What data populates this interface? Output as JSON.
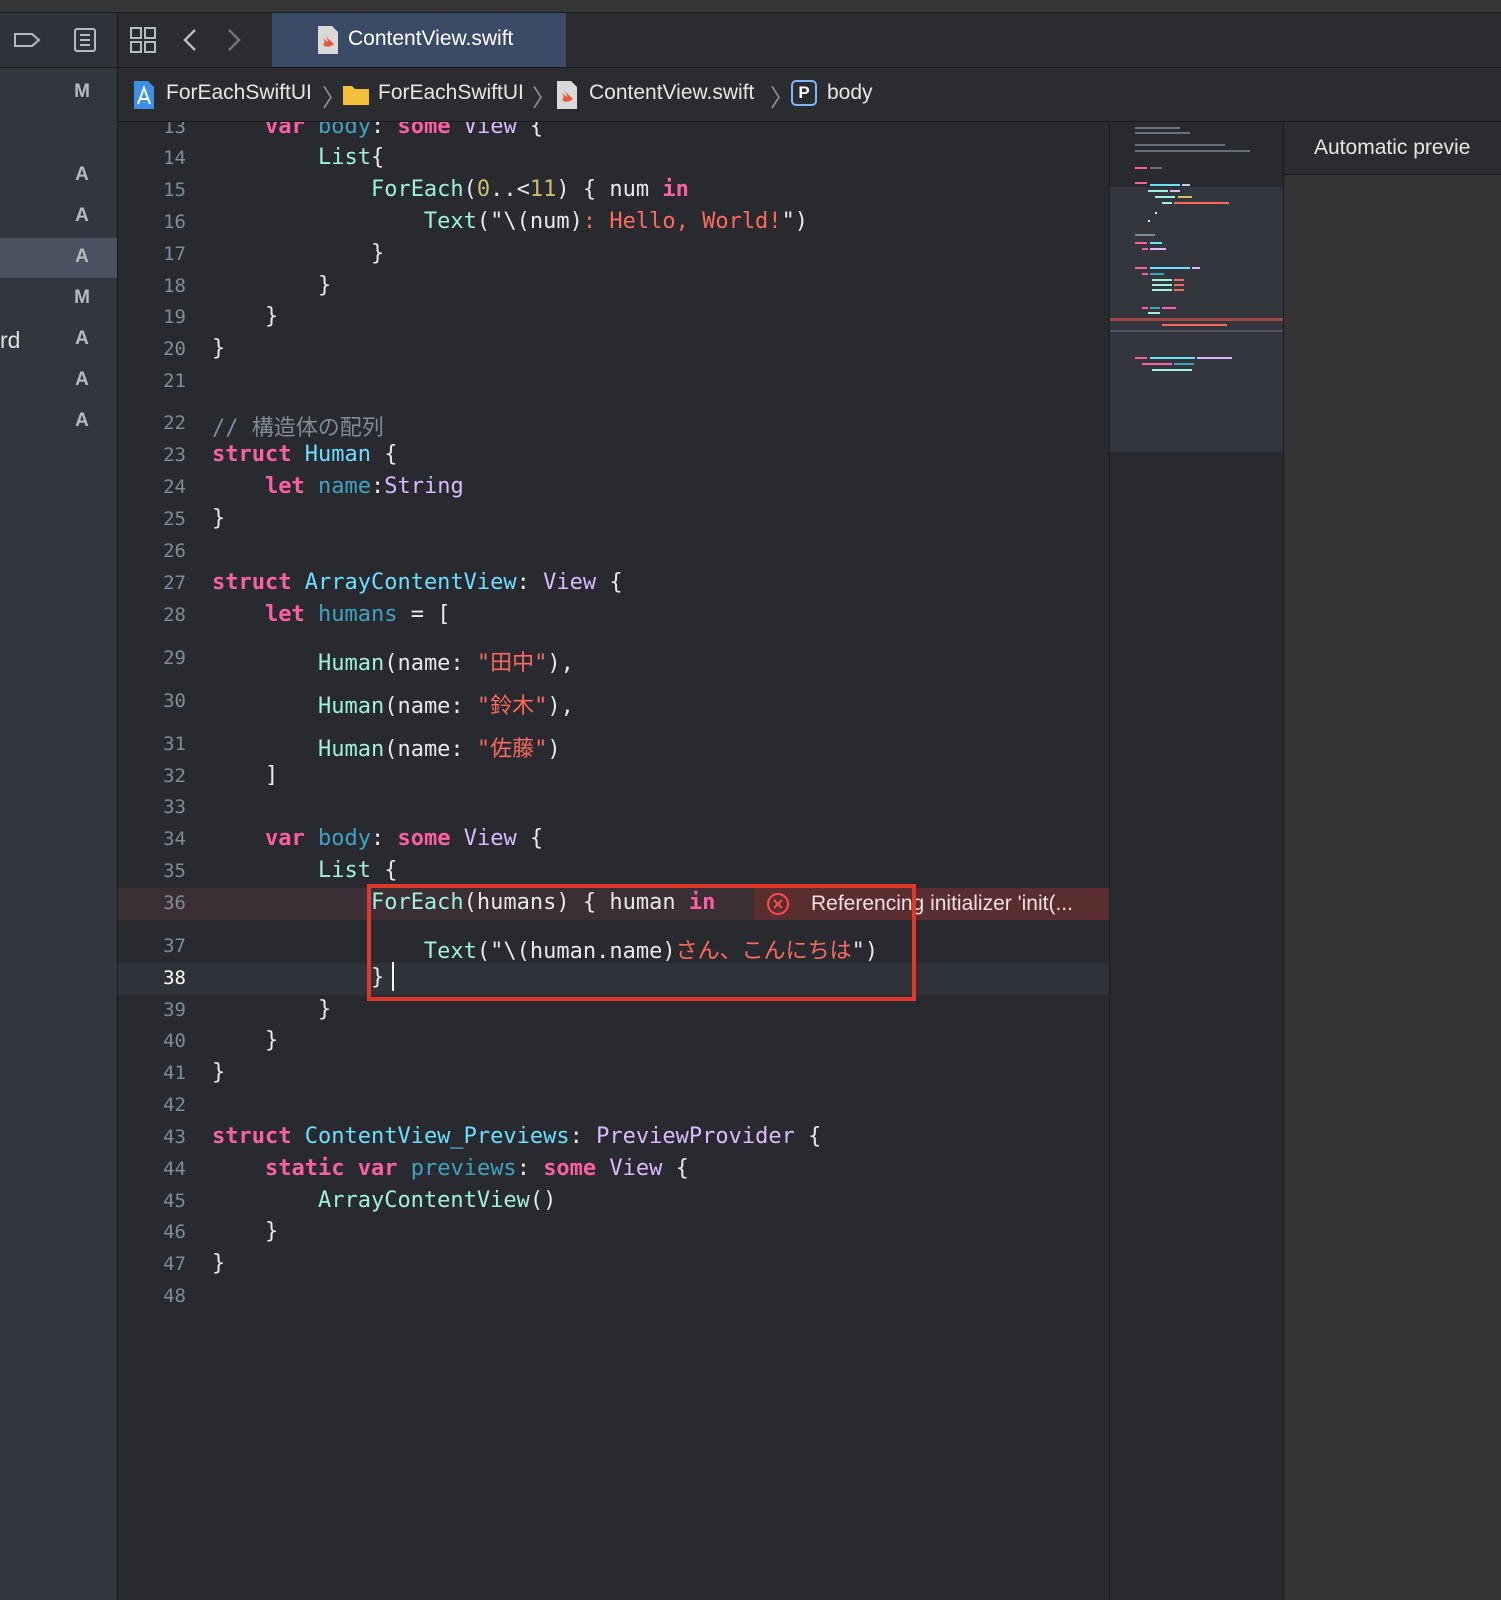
{
  "navigator": {
    "items": [
      {
        "name": "",
        "status": "M"
      },
      {
        "name": "",
        "status": "A"
      },
      {
        "name": "",
        "status": "A"
      },
      {
        "name": "",
        "status": "A"
      },
      {
        "name": "",
        "status": "M"
      },
      {
        "name": "rd",
        "status": "A"
      },
      {
        "name": "",
        "status": "A"
      },
      {
        "name": "",
        "status": "A"
      }
    ]
  },
  "tabs": {
    "active": "ContentView.swift"
  },
  "jumpbar": {
    "project": "ForEachSwiftUI",
    "group": "ForEachSwiftUI",
    "file": "ContentView.swift",
    "symbol_badge": "P",
    "symbol": "body"
  },
  "editor": {
    "error_message": "Referencing initializer 'init(...",
    "lines": [
      {
        "n": "13",
        "tokens": [
          [
            "    ",
            "pl"
          ],
          [
            "var",
            "kw"
          ],
          [
            " ",
            "pl"
          ],
          [
            "body",
            "pr"
          ],
          [
            ": ",
            "pl"
          ],
          [
            "some",
            "kw"
          ],
          [
            " ",
            "pl"
          ],
          [
            "View",
            "ty2"
          ],
          [
            " {",
            "pl"
          ]
        ]
      },
      {
        "n": "14",
        "tokens": [
          [
            "        ",
            "pl"
          ],
          [
            "List",
            "id"
          ],
          [
            "{",
            "pl"
          ]
        ]
      },
      {
        "n": "15",
        "tokens": [
          [
            "            ",
            "pl"
          ],
          [
            "ForEach",
            "id"
          ],
          [
            "(",
            "pl"
          ],
          [
            "0",
            "num"
          ],
          [
            "..<",
            "pl"
          ],
          [
            "11",
            "num"
          ],
          [
            ") { num ",
            "pl"
          ],
          [
            "in",
            "kw"
          ]
        ]
      },
      {
        "n": "16",
        "tokens": [
          [
            "                ",
            "pl"
          ],
          [
            "Text",
            "id"
          ],
          [
            "(\"\\(num)",
            "pl"
          ],
          [
            ": Hello, World!",
            "str"
          ],
          [
            "\")",
            "pl"
          ]
        ]
      },
      {
        "n": "17",
        "tokens": [
          [
            "            }",
            "pl"
          ]
        ]
      },
      {
        "n": "18",
        "tokens": [
          [
            "        }",
            "pl"
          ]
        ]
      },
      {
        "n": "19",
        "tokens": [
          [
            "    }",
            "pl"
          ]
        ]
      },
      {
        "n": "20",
        "tokens": [
          [
            "}",
            "pl"
          ]
        ]
      },
      {
        "n": "21",
        "tokens": []
      },
      {
        "n": "22",
        "tokens": [
          [
            "// 構造体の配列",
            "cm"
          ]
        ]
      },
      {
        "n": "23",
        "tokens": [
          [
            "struct",
            "kw"
          ],
          [
            " ",
            "pl"
          ],
          [
            "Human",
            "ty"
          ],
          [
            " {",
            "pl"
          ]
        ]
      },
      {
        "n": "24",
        "tokens": [
          [
            "    ",
            "pl"
          ],
          [
            "let",
            "kw"
          ],
          [
            " ",
            "pl"
          ],
          [
            "name",
            "pr"
          ],
          [
            ":",
            "pl"
          ],
          [
            "String",
            "ty2"
          ]
        ]
      },
      {
        "n": "25",
        "tokens": [
          [
            "}",
            "pl"
          ]
        ]
      },
      {
        "n": "26",
        "tokens": []
      },
      {
        "n": "27",
        "tokens": [
          [
            "struct",
            "kw"
          ],
          [
            " ",
            "pl"
          ],
          [
            "ArrayContentView",
            "ty"
          ],
          [
            ": ",
            "pl"
          ],
          [
            "View",
            "ty2"
          ],
          [
            " {",
            "pl"
          ]
        ]
      },
      {
        "n": "28",
        "tokens": [
          [
            "    ",
            "pl"
          ],
          [
            "let",
            "kw"
          ],
          [
            " ",
            "pl"
          ],
          [
            "humans",
            "pr"
          ],
          [
            " = [",
            "pl"
          ]
        ]
      },
      {
        "n": "29",
        "tokens": [
          [
            "        ",
            "pl"
          ],
          [
            "Human",
            "id"
          ],
          [
            "(name: ",
            "pl"
          ],
          [
            "\"田中\"",
            "str"
          ],
          [
            "),",
            "pl"
          ]
        ]
      },
      {
        "n": "30",
        "tokens": [
          [
            "        ",
            "pl"
          ],
          [
            "Human",
            "id"
          ],
          [
            "(name: ",
            "pl"
          ],
          [
            "\"鈴木\"",
            "str"
          ],
          [
            "),",
            "pl"
          ]
        ]
      },
      {
        "n": "31",
        "tokens": [
          [
            "        ",
            "pl"
          ],
          [
            "Human",
            "id"
          ],
          [
            "(name: ",
            "pl"
          ],
          [
            "\"佐藤\"",
            "str"
          ],
          [
            ")",
            "pl"
          ]
        ]
      },
      {
        "n": "32",
        "tokens": [
          [
            "    ]",
            "pl"
          ]
        ]
      },
      {
        "n": "33",
        "tokens": []
      },
      {
        "n": "34",
        "tokens": [
          [
            "    ",
            "pl"
          ],
          [
            "var",
            "kw"
          ],
          [
            " ",
            "pl"
          ],
          [
            "body",
            "pr"
          ],
          [
            ": ",
            "pl"
          ],
          [
            "some",
            "kw"
          ],
          [
            " ",
            "pl"
          ],
          [
            "View",
            "ty2"
          ],
          [
            " {",
            "pl"
          ]
        ]
      },
      {
        "n": "35",
        "tokens": [
          [
            "        ",
            "pl"
          ],
          [
            "List",
            "id"
          ],
          [
            " {",
            "pl"
          ]
        ]
      },
      {
        "n": "36",
        "tokens": [
          [
            "            ",
            "pl"
          ],
          [
            "ForEach",
            "id"
          ],
          [
            "(humans) { human ",
            "pl"
          ],
          [
            "in",
            "kw"
          ]
        ]
      },
      {
        "n": "37",
        "tokens": [
          [
            "                ",
            "pl"
          ],
          [
            "Text",
            "id"
          ],
          [
            "(\"\\(human.name)",
            "pl"
          ],
          [
            "さん、こんにちは",
            "str"
          ],
          [
            "\")",
            "pl"
          ]
        ]
      },
      {
        "n": "38",
        "tokens": [
          [
            "            }",
            "pl"
          ]
        ]
      },
      {
        "n": "39",
        "tokens": [
          [
            "        }",
            "pl"
          ]
        ]
      },
      {
        "n": "40",
        "tokens": [
          [
            "    }",
            "pl"
          ]
        ]
      },
      {
        "n": "41",
        "tokens": [
          [
            "}",
            "pl"
          ]
        ]
      },
      {
        "n": "42",
        "tokens": []
      },
      {
        "n": "43",
        "tokens": [
          [
            "struct",
            "kw"
          ],
          [
            " ",
            "pl"
          ],
          [
            "ContentView_Previews",
            "ty"
          ],
          [
            ": ",
            "pl"
          ],
          [
            "PreviewProvider",
            "ty2"
          ],
          [
            " {",
            "pl"
          ]
        ]
      },
      {
        "n": "44",
        "tokens": [
          [
            "    ",
            "pl"
          ],
          [
            "static",
            "kw"
          ],
          [
            " ",
            "pl"
          ],
          [
            "var",
            "kw"
          ],
          [
            " ",
            "pl"
          ],
          [
            "previews",
            "pr"
          ],
          [
            ": ",
            "pl"
          ],
          [
            "some",
            "kw"
          ],
          [
            " ",
            "pl"
          ],
          [
            "View",
            "ty2"
          ],
          [
            " {",
            "pl"
          ]
        ]
      },
      {
        "n": "45",
        "tokens": [
          [
            "        ",
            "pl"
          ],
          [
            "ArrayContentView",
            "id"
          ],
          [
            "()",
            "pl"
          ]
        ]
      },
      {
        "n": "46",
        "tokens": [
          [
            "    }",
            "pl"
          ]
        ]
      },
      {
        "n": "47",
        "tokens": [
          [
            "}",
            "pl"
          ]
        ]
      },
      {
        "n": "48",
        "tokens": []
      }
    ]
  },
  "canvas": {
    "title": "Automatic previe"
  }
}
